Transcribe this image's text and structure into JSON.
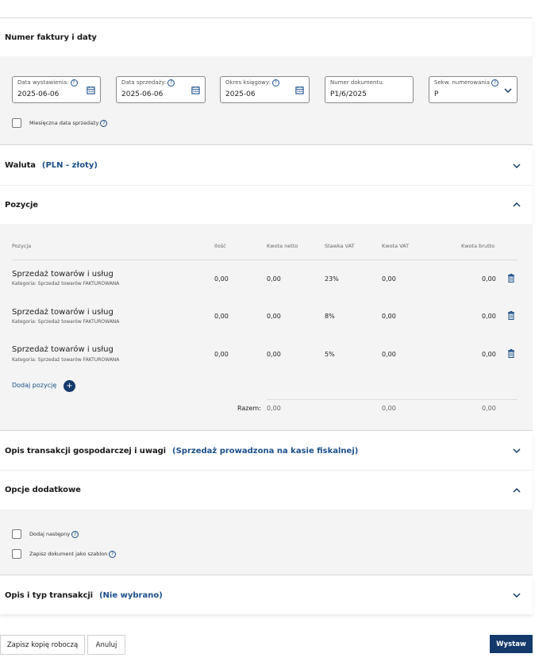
{
  "sections": {
    "invoice": {
      "title": "Numer faktury i daty"
    },
    "currency": {
      "title": "Waluta",
      "sub": "(PLN - złoty)"
    },
    "positions": {
      "title": "Pozycje"
    },
    "description": {
      "title": "Opis transakcji gospodarczej i uwagi",
      "sub": "(Sprzedaż prowadzona na kasie fiskalnej)"
    },
    "options": {
      "title": "Opcje dodatkowe"
    },
    "transaction": {
      "title": "Opis i typ transakcji",
      "sub": "(Nie wybrano)"
    }
  },
  "fields": {
    "issue_date": {
      "label": "Data wystawienia:",
      "value": "2025-06-06"
    },
    "sale_date": {
      "label": "Data sprzedaży:",
      "value": "2025-06-06"
    },
    "period": {
      "label": "Okres księgowy:",
      "value": "2025-06"
    },
    "doc_number": {
      "label": "Numer dokumentu:",
      "value": "P1/6/2025"
    },
    "numbering": {
      "label": "Sekw. numerowania",
      "value": "P"
    }
  },
  "monthly_sale_date": {
    "label": "Miesięczna data sprzedaży",
    "checked": false
  },
  "table": {
    "headers": [
      "Pozycja",
      "Ilość",
      "Kwota netto",
      "Stawka VAT",
      "Kwota VAT",
      "Kwota brutto"
    ],
    "rows": [
      {
        "name": "Sprzedaż towarów i usług",
        "category": "Kategoria: Sprzedaż towarów FAKTUROWANA",
        "qty": "0,00",
        "net": "0,00",
        "vat_rate": "23%",
        "vat": "0,00",
        "gross": "0,00"
      },
      {
        "name": "Sprzedaż towarów i usług",
        "category": "Kategoria: Sprzedaż towarów FAKTUROWANA",
        "qty": "0,00",
        "net": "0,00",
        "vat_rate": "8%",
        "vat": "0,00",
        "gross": "0,00"
      },
      {
        "name": "Sprzedaż towarów i usług",
        "category": "Kategoria: Sprzedaż towarów FAKTUROWANA",
        "qty": "0,00",
        "net": "0,00",
        "vat_rate": "5%",
        "vat": "0,00",
        "gross": "0,00"
      }
    ],
    "add_label": "Dodaj pozycję",
    "add_icon": "+",
    "total": {
      "label": "Razem:",
      "net": "0,00",
      "vat": "0,00",
      "gross": "0,00"
    }
  },
  "options": {
    "add_next": {
      "label": "Dodaj następny",
      "checked": false
    },
    "save_template": {
      "label": "Zapisz dokument jako szablon",
      "checked": false
    }
  },
  "buttons": {
    "save_draft": "Zapisz kopię roboczą",
    "cancel": "Anuluj",
    "issue": "Wystaw"
  },
  "info_glyph": "?",
  "colors": {
    "accent": "#14396b",
    "link": "#1b4f8a",
    "body_bg": "#f4f4f4"
  }
}
